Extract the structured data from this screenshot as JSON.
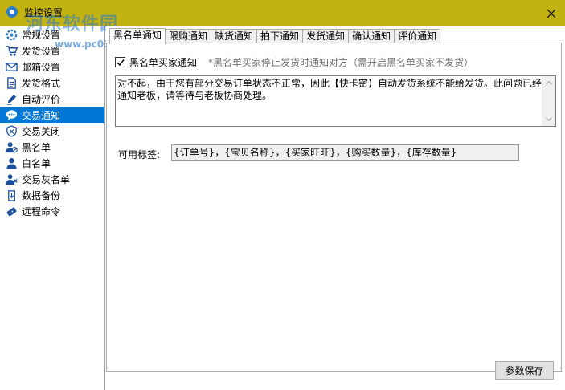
{
  "window": {
    "title": "监控设置",
    "watermark_line1": "河东软件园",
    "watermark_line2": "www.pc0359.cn",
    "titlebar_color": "#c3b312"
  },
  "sidebar": {
    "items": [
      {
        "label": "常规设置",
        "icon": "gear-icon"
      },
      {
        "label": "发货设置",
        "icon": "cart-icon"
      },
      {
        "label": "邮箱设置",
        "icon": "mail-icon"
      },
      {
        "label": "发货格式",
        "icon": "document-icon"
      },
      {
        "label": "自动评价",
        "icon": "pen-icon"
      },
      {
        "label": "交易通知",
        "icon": "chat-bubble-icon",
        "selected": true
      },
      {
        "label": "交易关闭",
        "icon": "shield-icon"
      },
      {
        "label": "黑名单",
        "icon": "user-block-icon"
      },
      {
        "label": "白名单",
        "icon": "user-icon"
      },
      {
        "label": "交易灰名单",
        "icon": "users-icon"
      },
      {
        "label": "数据备份",
        "icon": "backup-icon"
      },
      {
        "label": "远程命令",
        "icon": "remote-icon"
      }
    ],
    "selected_color": "#0078d7"
  },
  "tabs": [
    {
      "label": "黑名单通知",
      "active": true
    },
    {
      "label": "限购通知"
    },
    {
      "label": "缺货通知"
    },
    {
      "label": "拍下通知"
    },
    {
      "label": "发货通知"
    },
    {
      "label": "确认通知"
    },
    {
      "label": "评价通知"
    }
  ],
  "panel": {
    "checkbox_label": "黑名单买家通知",
    "checkbox_checked": true,
    "hint": "*黑名单买家停止发货时通知对方（需开启黑名单买家不发货）",
    "message": "对不起，由于您有部分交易订单状态不正常，因此【快卡密】自动发货系统不能给发货。此问题已经通知老板，请等待与老板协商处理。",
    "tags_label": "可用标签:",
    "tags_value": "{订单号}，{宝贝名称}，{买家旺旺}，{购买数量}，{库存数量}"
  },
  "footer": {
    "save_label": "参数保存"
  }
}
